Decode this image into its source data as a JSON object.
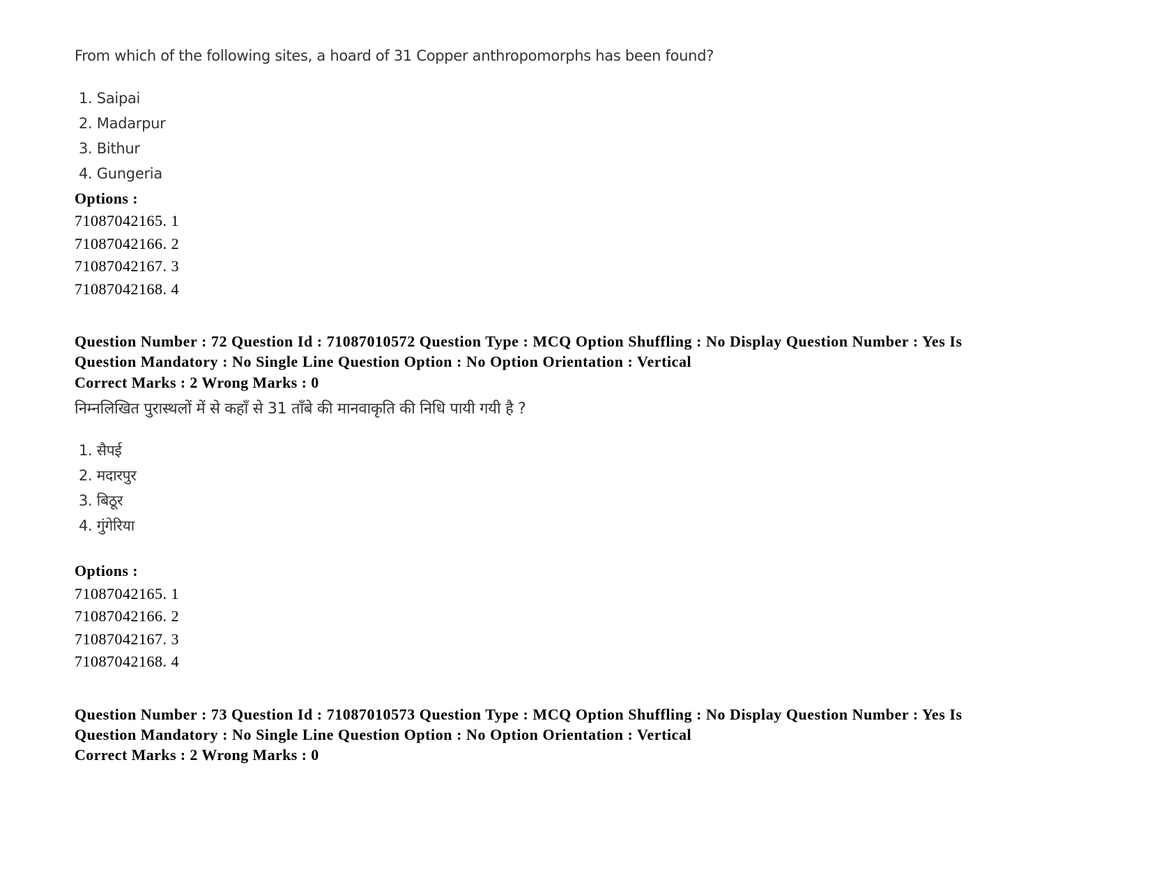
{
  "question_71": {
    "text_en": "From which of the following sites, a hoard of 31 Copper anthropomorphs has been found?",
    "items_en": [
      "1. Saipai",
      "2. Madarpur",
      "3. Bithur",
      "4. Gungeria"
    ],
    "options_label": "Options :",
    "options": [
      "71087042165. 1",
      "71087042166. 2",
      "71087042167. 3",
      "71087042168. 4"
    ]
  },
  "question_72": {
    "meta_line1": "Question Number : 72 Question Id : 71087010572 Question Type : MCQ Option Shuffling : No Display Question Number : Yes Is",
    "meta_line2": "Question Mandatory : No Single Line Question Option : No Option Orientation : Vertical",
    "marks": "Correct Marks : 2 Wrong Marks : 0",
    "text_hi": "निम्नलिखित पुरास्थलों में से कहाँ से 31 ताँबे की मानवाकृति की निधि पायी गयी है ?",
    "items_hi": [
      "1. सैपई",
      "2. मदारपुर",
      "3. बिठूर",
      "4. गुंगेरिया"
    ],
    "options_label": "Options :",
    "options": [
      "71087042165. 1",
      "71087042166. 2",
      "71087042167. 3",
      "71087042168. 4"
    ]
  },
  "question_73": {
    "meta_line1": "Question Number : 73 Question Id : 71087010573 Question Type : MCQ Option Shuffling : No Display Question Number : Yes Is",
    "meta_line2": "Question Mandatory : No Single Line Question Option : No Option Orientation : Vertical",
    "marks": "Correct Marks : 2 Wrong Marks : 0"
  }
}
